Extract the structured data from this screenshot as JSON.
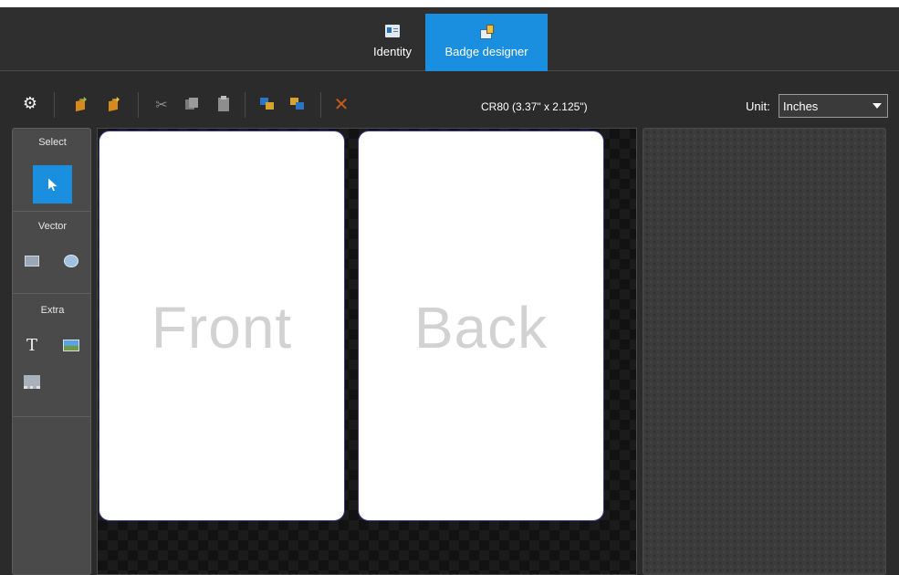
{
  "tabs": [
    {
      "label": "Identity",
      "icon": "identity-card-icon"
    },
    {
      "label": "Badge designer",
      "icon": "badge-designer-icon"
    }
  ],
  "active_tab": "Badge designer",
  "toolbar": {
    "format_label": "CR80 (3.37\" x 2.125\")",
    "unit_label": "Unit:",
    "unit_value": "Inches",
    "icons": [
      "gear-icon",
      "import-icon",
      "export-icon",
      "cut-icon",
      "copy-icon",
      "paste-icon",
      "bring-to-front-icon",
      "send-to-back-icon",
      "delete-icon"
    ]
  },
  "palette": {
    "select_label": "Select",
    "vector_label": "Vector",
    "extra_label": "Extra",
    "text_tool_glyph": "T"
  },
  "canvas": {
    "front_label": "Front",
    "back_label": "Back"
  },
  "colors": {
    "accent": "#1a8fdf",
    "background": "#2b2b2b",
    "card": "#ffffff",
    "delete": "#c85a1e"
  }
}
